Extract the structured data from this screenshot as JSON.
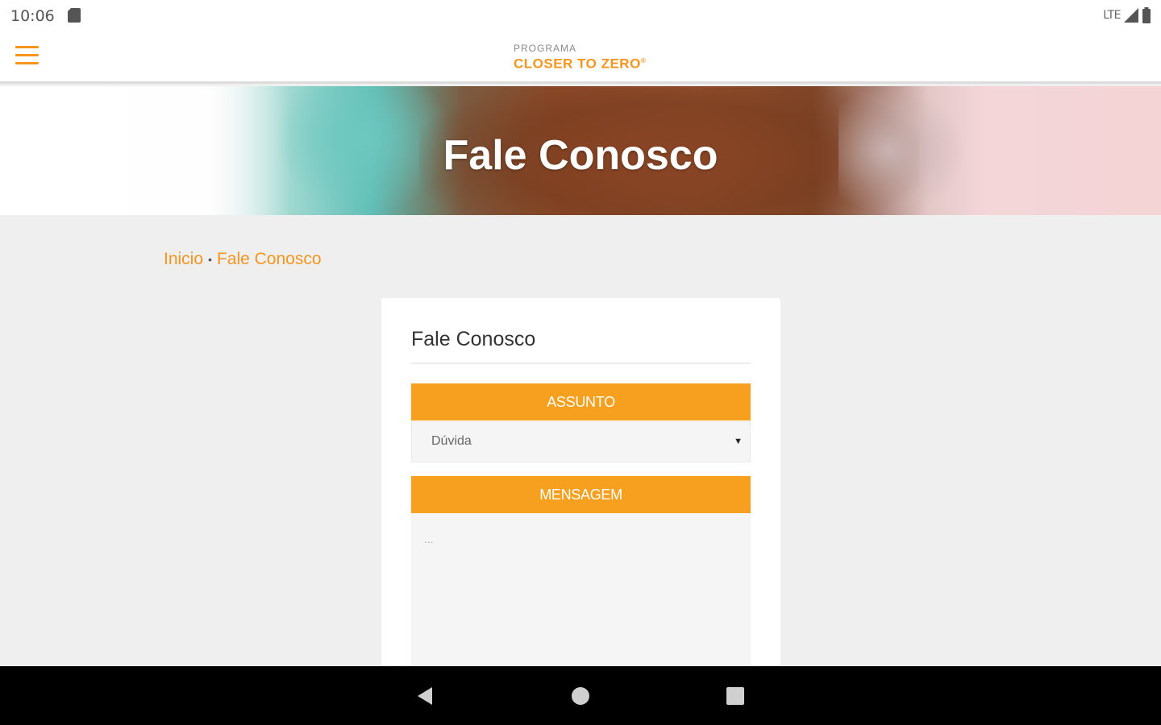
{
  "status_bar": {
    "time": "10:06",
    "network": "LTE",
    "icons": [
      "sd-card-icon",
      "signal-icon",
      "battery-icon"
    ]
  },
  "app_bar": {
    "menu_icon": "hamburger-menu-icon",
    "logo_top": "PROGRAMA",
    "logo_main": "CLOSER TO ZERO",
    "logo_mark": "®"
  },
  "hero": {
    "title": "Fale Conosco"
  },
  "breadcrumb": {
    "home": "Inicio",
    "separator": "•",
    "current": "Fale Conosco"
  },
  "form": {
    "title": "Fale Conosco",
    "subject_header": "ASSUNTO",
    "subject_value": "Dúvida",
    "message_header": "MENSAGEM",
    "message_placeholder": "..."
  },
  "nav_bar": {
    "icons": [
      "back-icon",
      "home-icon",
      "recent-apps-icon"
    ]
  },
  "colors": {
    "accent": "#f7941d",
    "field_header": "#f7a01f",
    "background": "#efefef",
    "card": "#ffffff"
  }
}
